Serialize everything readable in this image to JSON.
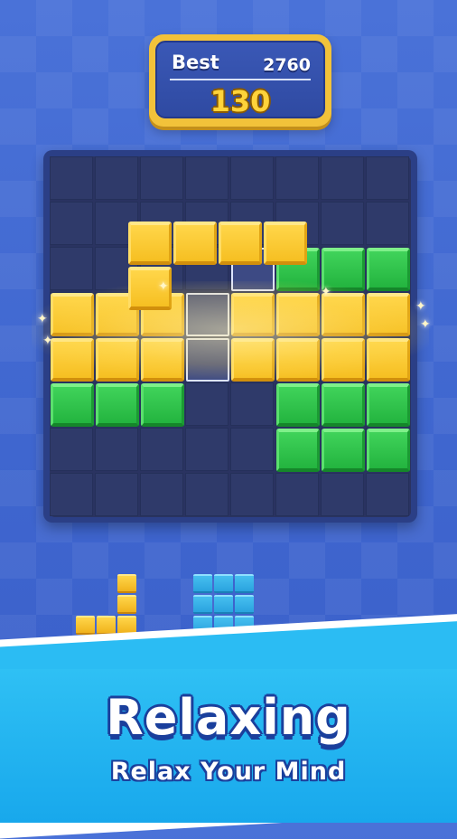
{
  "score_panel": {
    "best_label": "Best",
    "best_value": "2760",
    "current_score": "130"
  },
  "board": {
    "rows": 8,
    "cols": 8,
    "colors": {
      "yellow": "#f6bf22",
      "green": "#23b43f",
      "empty": "#2f3a6a"
    },
    "cells": [
      [
        0,
        0,
        0,
        0,
        0,
        0,
        0,
        0
      ],
      [
        0,
        0,
        0,
        0,
        0,
        0,
        0,
        0
      ],
      [
        0,
        0,
        0,
        0,
        0,
        "G",
        "G",
        "G"
      ],
      [
        "Y",
        "Y",
        "Y",
        0,
        "Y",
        "Y",
        "Y",
        "Y"
      ],
      [
        "Y",
        "Y",
        "Y",
        0,
        "Y",
        "Y",
        "Y",
        "Y"
      ],
      [
        "G",
        "G",
        "G",
        0,
        0,
        "G",
        "G",
        "G"
      ],
      [
        0,
        0,
        0,
        0,
        0,
        "G",
        "G",
        "G"
      ],
      [
        0,
        0,
        0,
        0,
        0,
        0,
        0,
        0
      ]
    ],
    "dragged_piece": {
      "color": "yellow",
      "cells": [
        [
          1.5,
          2.75
        ],
        [
          1.5,
          3.75
        ],
        [
          2.5,
          2.75
        ],
        [
          3.5,
          2.75
        ],
        [
          4.5,
          2.75
        ]
      ]
    },
    "placement_preview": [
      [
        2,
        4
      ],
      [
        3,
        3
      ],
      [
        4,
        3
      ]
    ],
    "highlighted_rows": [
      3,
      4
    ]
  },
  "tray": [
    {
      "name": "yellow-l-piece",
      "color": "yellow",
      "cells": [
        [
          0,
          2
        ],
        [
          1,
          2
        ],
        [
          2,
          0
        ],
        [
          2,
          1
        ],
        [
          2,
          2
        ]
      ]
    },
    {
      "name": "blue-square-piece",
      "color": "blue",
      "cells": [
        [
          0,
          0
        ],
        [
          0,
          1
        ],
        [
          0,
          2
        ],
        [
          1,
          0
        ],
        [
          1,
          1
        ],
        [
          1,
          2
        ],
        [
          2,
          0
        ],
        [
          2,
          1
        ],
        [
          2,
          2
        ]
      ]
    }
  ],
  "banner": {
    "headline": "Relaxing",
    "subline": "Relax Your Mind"
  }
}
